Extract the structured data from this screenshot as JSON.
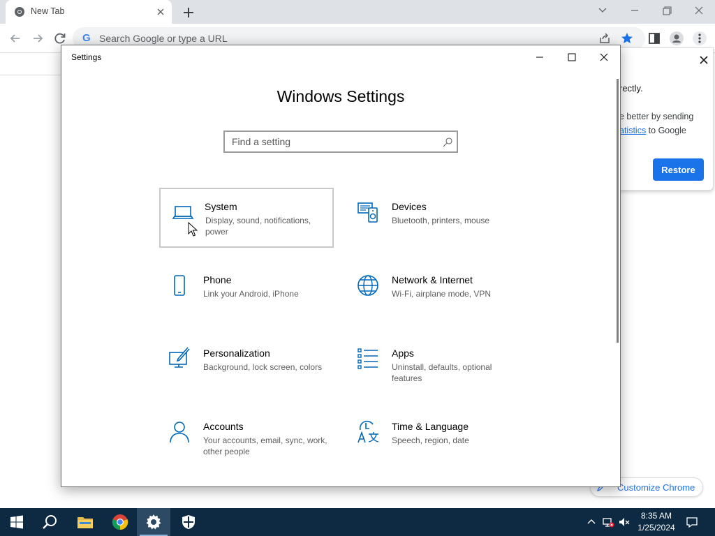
{
  "chrome": {
    "tab_title": "New Tab",
    "omnibox_placeholder": "Search Google or type a URL",
    "omnibox_g": "G",
    "accent": "#1a73e8"
  },
  "restore_popup": {
    "line1": "rectly.",
    "line2": "e better by sending",
    "line3_link": "atistics",
    "line3_rest": " to Google",
    "restore_label": "Restore"
  },
  "customize_chrome": "Customize Chrome",
  "settings": {
    "window_title": "Settings",
    "heading": "Windows Settings",
    "search_placeholder": "Find a setting",
    "accent": "#0067b8",
    "tiles": [
      {
        "name": "System",
        "desc": "Display, sound, notifications, power",
        "icon": "laptop-icon"
      },
      {
        "name": "Devices",
        "desc": "Bluetooth, printers, mouse",
        "icon": "devices-icon"
      },
      {
        "name": "Phone",
        "desc": "Link your Android, iPhone",
        "icon": "phone-icon"
      },
      {
        "name": "Network & Internet",
        "desc": "Wi-Fi, airplane mode, VPN",
        "icon": "globe-icon"
      },
      {
        "name": "Personalization",
        "desc": "Background, lock screen, colors",
        "icon": "personalization-icon"
      },
      {
        "name": "Apps",
        "desc": "Uninstall, defaults, optional features",
        "icon": "apps-icon"
      },
      {
        "name": "Accounts",
        "desc": "Your accounts, email, sync, work, other people",
        "icon": "person-icon"
      },
      {
        "name": "Time & Language",
        "desc": "Speech, region, date",
        "icon": "time-language-icon"
      }
    ]
  },
  "taskbar": {
    "time": "8:35 AM",
    "date": "1/25/2024"
  }
}
